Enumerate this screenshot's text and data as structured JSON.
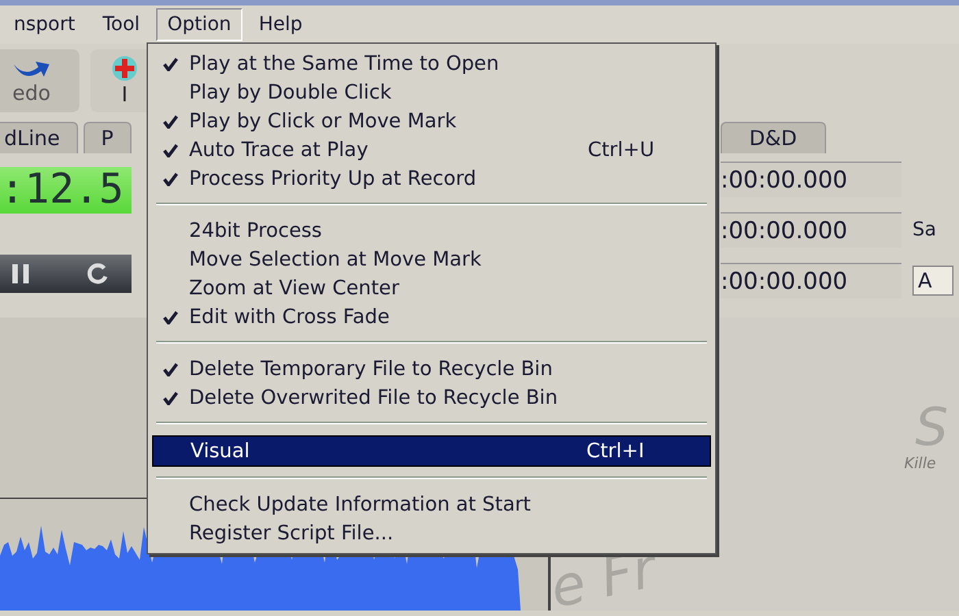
{
  "menubar": {
    "items": [
      {
        "label": "nsport",
        "selected": false
      },
      {
        "label": "Tool",
        "selected": false
      },
      {
        "label": "Option",
        "selected": true
      },
      {
        "label": "Help",
        "selected": false
      }
    ]
  },
  "toolbar": {
    "buttons": [
      {
        "label": "edo",
        "kind": "redo"
      },
      {
        "label": "I",
        "kind": "insert"
      }
    ]
  },
  "tabs": [
    {
      "label": "dLine",
      "selected": false
    },
    {
      "label": "P",
      "selected": false
    },
    {
      "label": "D&D",
      "selected": false
    }
  ],
  "time_display": ":12.5",
  "time_fields": [
    {
      "value": ":00:00.000"
    },
    {
      "value": ":00:00.000"
    },
    {
      "value": ":00:00.000"
    }
  ],
  "side_label": "Sa",
  "side_dropdown": "A",
  "background_logo": [
    {
      "text": "S"
    },
    {
      "text": "Kille"
    },
    {
      "text": "e Fr"
    }
  ],
  "option_menu": [
    {
      "kind": "item",
      "label": "Play at the Same Time to Open",
      "checked": true,
      "selected": false
    },
    {
      "kind": "item",
      "label": "Play by Double Click",
      "checked": false,
      "selected": false
    },
    {
      "kind": "item",
      "label": "Play by Click or Move Mark",
      "checked": true,
      "selected": false
    },
    {
      "kind": "item",
      "label": "Auto Trace at Play",
      "checked": true,
      "selected": false,
      "shortcut": "Ctrl+U"
    },
    {
      "kind": "item",
      "label": "Process Priority Up at Record",
      "checked": true,
      "selected": false
    },
    {
      "kind": "separator"
    },
    {
      "kind": "item",
      "label": "24bit Process",
      "checked": false,
      "selected": false
    },
    {
      "kind": "item",
      "label": "Move Selection at Move Mark",
      "checked": false,
      "selected": false
    },
    {
      "kind": "item",
      "label": "Zoom at View Center",
      "checked": false,
      "selected": false
    },
    {
      "kind": "item",
      "label": "Edit with Cross Fade",
      "checked": true,
      "selected": false
    },
    {
      "kind": "separator"
    },
    {
      "kind": "item",
      "label": "Delete Temporary File to Recycle Bin",
      "checked": true,
      "selected": false
    },
    {
      "kind": "item",
      "label": "Delete Overwrited File to Recycle Bin",
      "checked": true,
      "selected": false
    },
    {
      "kind": "separator"
    },
    {
      "kind": "item",
      "label": "Visual",
      "checked": false,
      "selected": true,
      "shortcut": "Ctrl+I"
    },
    {
      "kind": "separator"
    },
    {
      "kind": "item",
      "label": "Check Update Information at Start",
      "checked": false,
      "selected": false
    },
    {
      "kind": "item",
      "label": "Register Script File...",
      "checked": false,
      "selected": false
    }
  ]
}
